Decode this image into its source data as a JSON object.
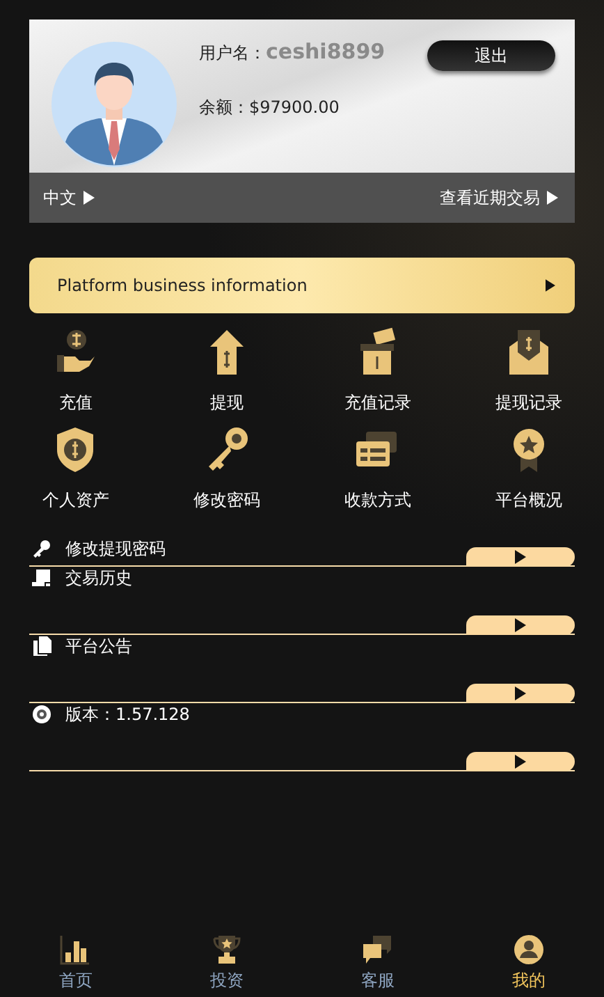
{
  "profile": {
    "username_label": "用户名：",
    "username": "ceshi8899",
    "balance_label": "余额：",
    "balance": "$97900.00",
    "logout": "退出",
    "language": "中文",
    "recent": "查看近期交易"
  },
  "banner": "Platform business information",
  "grid": [
    {
      "label": "充值",
      "kind": "deposit"
    },
    {
      "label": "提现",
      "kind": "withdraw"
    },
    {
      "label": "充值记录",
      "kind": "box"
    },
    {
      "label": "提现记录",
      "kind": "envelope"
    },
    {
      "label": "个人资产",
      "kind": "shield"
    },
    {
      "label": "修改密码",
      "kind": "key"
    },
    {
      "label": "收款方式",
      "kind": "card"
    },
    {
      "label": "平台概况",
      "kind": "medal"
    }
  ],
  "menu": [
    {
      "label": "修改提现密码",
      "kind": "key"
    },
    {
      "label": "交易历史",
      "kind": "document"
    },
    {
      "label": "平台公告",
      "kind": "copy"
    },
    {
      "label": "版本：1.57.128",
      "kind": "disc"
    }
  ],
  "nav": [
    {
      "label": "首页",
      "kind": "chart",
      "selected": false
    },
    {
      "label": "投资",
      "kind": "trophy",
      "selected": false
    },
    {
      "label": "客服",
      "kind": "chat",
      "selected": false
    },
    {
      "label": "我的",
      "kind": "user",
      "selected": true
    }
  ]
}
